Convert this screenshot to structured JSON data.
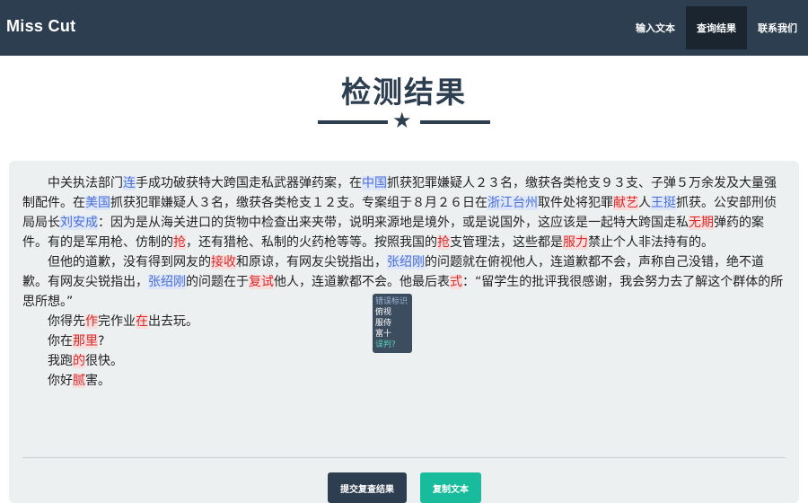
{
  "navbar": {
    "brand": "Miss Cut",
    "links": [
      {
        "label": "输入文本",
        "active": false
      },
      {
        "label": "查询结果",
        "active": true
      },
      {
        "label": "联系我们",
        "active": false
      }
    ]
  },
  "page": {
    "title": "检测结果"
  },
  "tooltip": {
    "head": "错误标识",
    "items": [
      "俯视",
      "服侍",
      "富十"
    ],
    "foot": "误判?"
  },
  "buttons": {
    "submit": "提交复查结果",
    "copy": "复制文本"
  },
  "colors": {
    "navbar": "#2c3e50",
    "accent": "#18bc9c",
    "highlight_blue": "#4a6fd0",
    "highlight_red": "#d62b2b"
  },
  "text": {
    "p1": [
      {
        "t": "中关执法部门",
        "m": ""
      },
      {
        "t": "连",
        "m": "blue"
      },
      {
        "t": "手成功破获特大跨国走私武器弹药案，在",
        "m": ""
      },
      {
        "t": "中国",
        "m": "blue"
      },
      {
        "t": "抓获犯罪嫌疑人２３名，缴获各类枪支９３支、子弹５万余发及大量强制配件。在",
        "m": ""
      },
      {
        "t": "美国",
        "m": "blue"
      },
      {
        "t": "抓获犯罪嫌疑人３名，缴获各类枪支１２支。专案组于８月２６日在",
        "m": ""
      },
      {
        "t": "浙江台州",
        "m": "blue"
      },
      {
        "t": "取件处将犯罪",
        "m": ""
      },
      {
        "t": "献艺",
        "m": "red"
      },
      {
        "t": "人",
        "m": ""
      },
      {
        "t": "王挺",
        "m": "blue"
      },
      {
        "t": "抓获。公安部刑侦局局长",
        "m": ""
      },
      {
        "t": "刘安成",
        "m": "blue"
      },
      {
        "t": "：因为是从海关进口的货物中检查出来夹带，说明来源地是境外，或是说国外，这应该是一起特大跨国走私",
        "m": ""
      },
      {
        "t": "无期",
        "m": "red"
      },
      {
        "t": "弹药的案件。有的是军用枪、仿制的",
        "m": ""
      },
      {
        "t": "抢",
        "m": "red"
      },
      {
        "t": "，还有猎枪、私制的火药枪等等。按照我国的",
        "m": ""
      },
      {
        "t": "抢",
        "m": "red"
      },
      {
        "t": "支管理法，这些都是",
        "m": ""
      },
      {
        "t": "服力",
        "m": "red"
      },
      {
        "t": "禁止个人非法持有的。",
        "m": ""
      }
    ],
    "p2": [
      {
        "t": "但他的道歉，没有得到网友的",
        "m": ""
      },
      {
        "t": "接收",
        "m": "red"
      },
      {
        "t": "和原谅，有网友尖锐指出，",
        "m": ""
      },
      {
        "t": "张绍刚",
        "m": "blue"
      },
      {
        "t": "的问题就在俯视他人，连道歉都不会，声称自己没错，绝不道歉。有网友尖锐指出，",
        "m": ""
      },
      {
        "t": "张绍刚",
        "m": "blue"
      },
      {
        "t": "的问题在于",
        "m": ""
      },
      {
        "t": "复试",
        "m": "red"
      },
      {
        "t": "他人，连道歉都不会。他最后表",
        "m": ""
      },
      {
        "t": "式",
        "m": "red"
      },
      {
        "t": "：“留学生的批评我很感谢，我会努力去了解这个群体的所思所想。”",
        "m": ""
      }
    ],
    "l3": [
      {
        "t": "你得先",
        "m": ""
      },
      {
        "t": "作",
        "m": "red"
      },
      {
        "t": "完作业",
        "m": ""
      },
      {
        "t": "在",
        "m": "red"
      },
      {
        "t": "出去玩。",
        "m": ""
      }
    ],
    "l4": [
      {
        "t": "你在",
        "m": ""
      },
      {
        "t": "那里",
        "m": "red"
      },
      {
        "t": "?",
        "m": ""
      }
    ],
    "l5": [
      {
        "t": "我跑",
        "m": ""
      },
      {
        "t": "的",
        "m": "red"
      },
      {
        "t": "很快。",
        "m": ""
      }
    ],
    "l6": [
      {
        "t": "你好",
        "m": ""
      },
      {
        "t": "腻",
        "m": "red"
      },
      {
        "t": "害。",
        "m": ""
      }
    ]
  }
}
